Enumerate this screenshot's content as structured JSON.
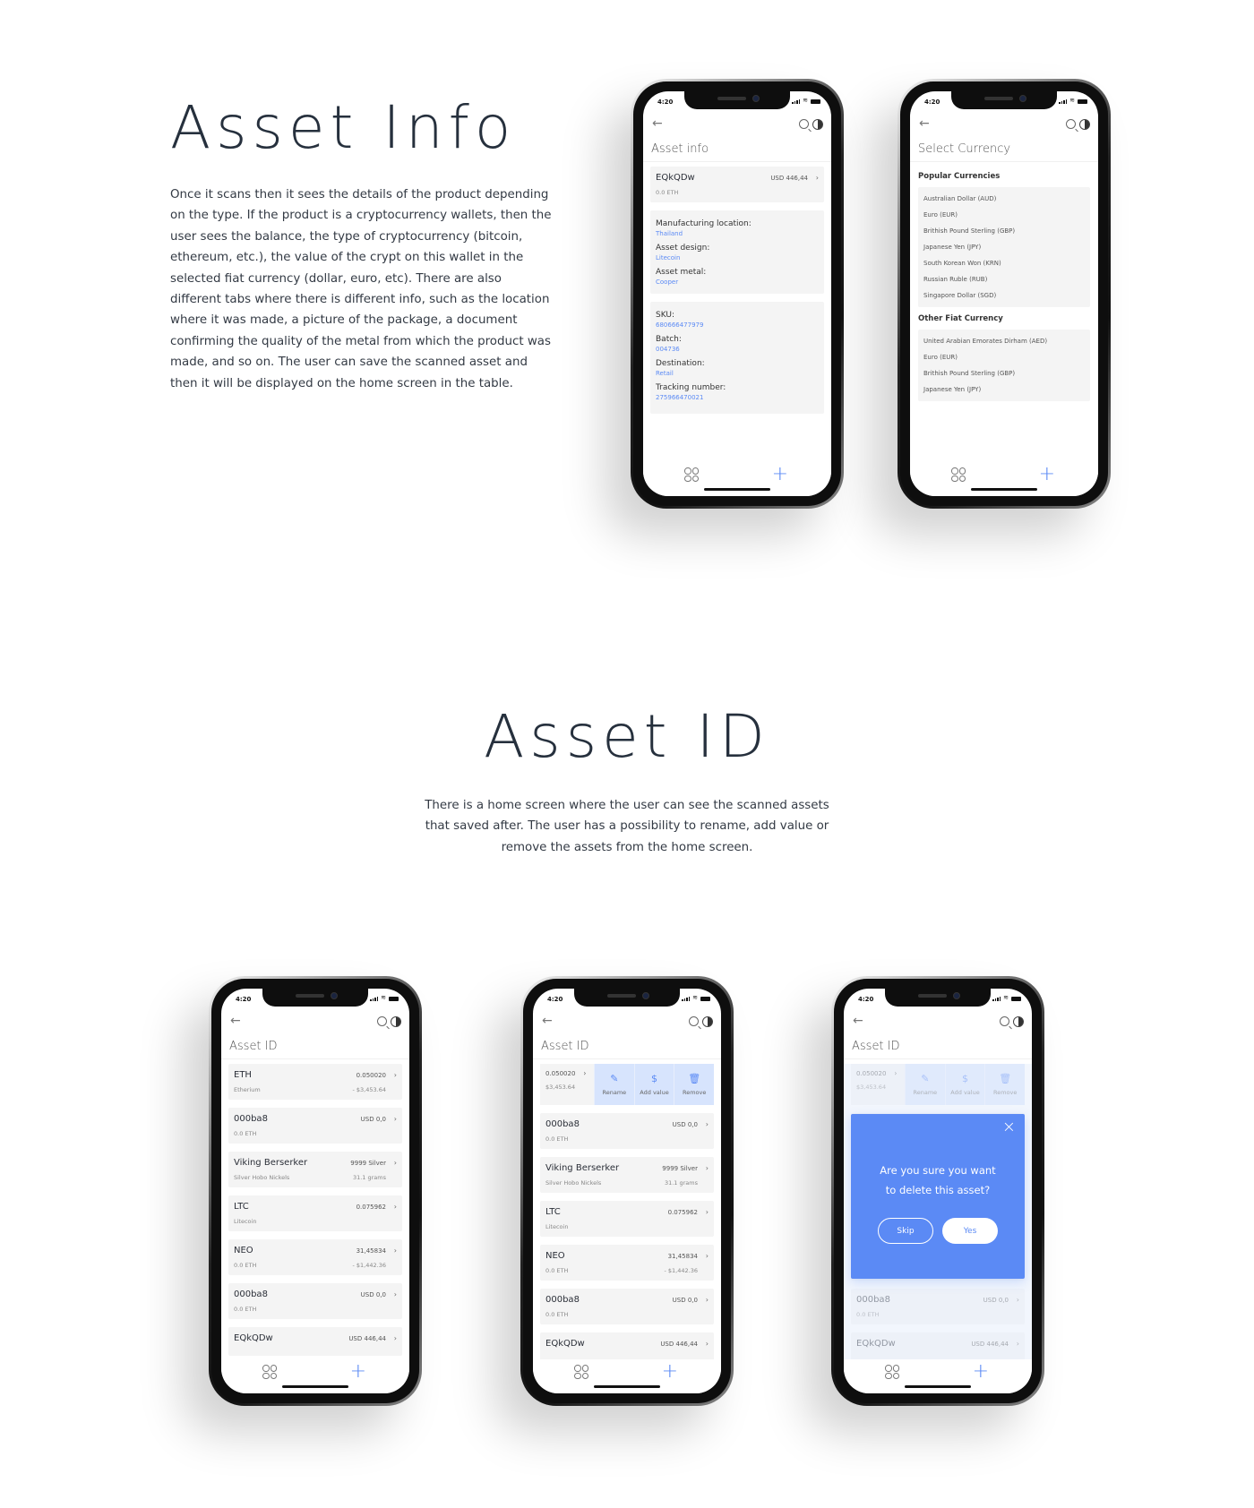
{
  "section1": {
    "heading": "Asset Info",
    "description": "Once it scans then it sees the details of the product depending on the type. If the product is a cryptocurrency wallets, then the user sees the balance, the type of cryptocurrency (bitcoin, ethereum, etc.), the value of the crypt on this wallet in the selected fiat currency (dollar, euro, etc). There are also different tabs where there is different info, such as the location where it was made, a picture of the package, a document confirming the quality of the metal from which the product was made, and so on. The user can save the scanned asset and then it will be displayed on the home screen in the table."
  },
  "section2": {
    "heading": "Asset ID",
    "description": "There is a home screen where the user can see the scanned assets that saved after. The user has a possibility to rename, add value or remove the assets from the home screen."
  },
  "status": {
    "time": "4:20"
  },
  "colors": {
    "accent": "#5b8af5",
    "card": "#f4f4f4",
    "action_bg": "#d7e4fd",
    "heading": "#26303d"
  },
  "icons": {
    "back": "←",
    "chevron": "›",
    "plus": "+",
    "close": "×",
    "pencil": "✎",
    "dollar": "$",
    "trash": "🗑"
  },
  "asset_info_screen": {
    "title": "Asset info",
    "wallet": {
      "name": "EQkQDw",
      "value": "USD 446,44",
      "sub": "0.0 ETH"
    },
    "group1": [
      {
        "label": "Manufacturing location:",
        "value": "Thailand"
      },
      {
        "label": "Asset design:",
        "value": "Litecoin"
      },
      {
        "label": "Asset metal:",
        "value": "Cooper"
      }
    ],
    "group2": [
      {
        "label": "SKU:",
        "value": "680666477979"
      },
      {
        "label": "Batch:",
        "value": "004736"
      },
      {
        "label": "Destination:",
        "value": "Retail"
      },
      {
        "label": "Tracking number:",
        "value": "275966470021"
      }
    ]
  },
  "currency_screen": {
    "title": "Select Currency",
    "popular_heading": "Popular Currencies",
    "popular": [
      "Australian Dollar (AUD)",
      "Euro (EUR)",
      "Brithish Pound Sterling (GBP)",
      "Japanese Yen (JPY)",
      "South Korean Won (KRN)",
      "Russian Ruble (RUB)",
      "Singapore Dollar (SGD)"
    ],
    "other_heading": "Other Fiat Currency",
    "other": [
      "United Arabian Emorates Dirham (AED)",
      "Euro (EUR)",
      "Brithish Pound Sterling (GBP)",
      "Japanese Yen (JPY)"
    ]
  },
  "asset_id_screen": {
    "title": "Asset ID",
    "items": [
      {
        "name": "ETH",
        "value": "0.050020",
        "sub": "Etherium",
        "subv": "- $3,453.64"
      },
      {
        "name": "000ba8",
        "value": "USD 0,0",
        "sub": "0.0 ETH",
        "subv": ""
      },
      {
        "name": "Viking Berserker",
        "value": "9999 Silver",
        "sub": "Silver Hobo Nickels",
        "subv": "31.1 grams"
      },
      {
        "name": "LTC",
        "value": "0.075962",
        "sub": "Litecoin",
        "subv": ""
      },
      {
        "name": "NEO",
        "value": "31,45834",
        "sub": "0.0 ETH",
        "subv": "- $1,442.36"
      },
      {
        "name": "000ba8",
        "value": "USD 0,0",
        "sub": "0.0 ETH",
        "subv": ""
      },
      {
        "name": "EQkQDw",
        "value": "USD 446,44",
        "sub": "",
        "subv": ""
      }
    ],
    "swiped": {
      "value": "0.050020",
      "sub": "$3,453.64"
    },
    "actions": [
      "Rename",
      "Add value",
      "Remove"
    ]
  },
  "delete_dialog": {
    "line1": "Are you sure you want",
    "line2": "to delete this asset?",
    "skip": "Skip",
    "yes": "Yes"
  }
}
